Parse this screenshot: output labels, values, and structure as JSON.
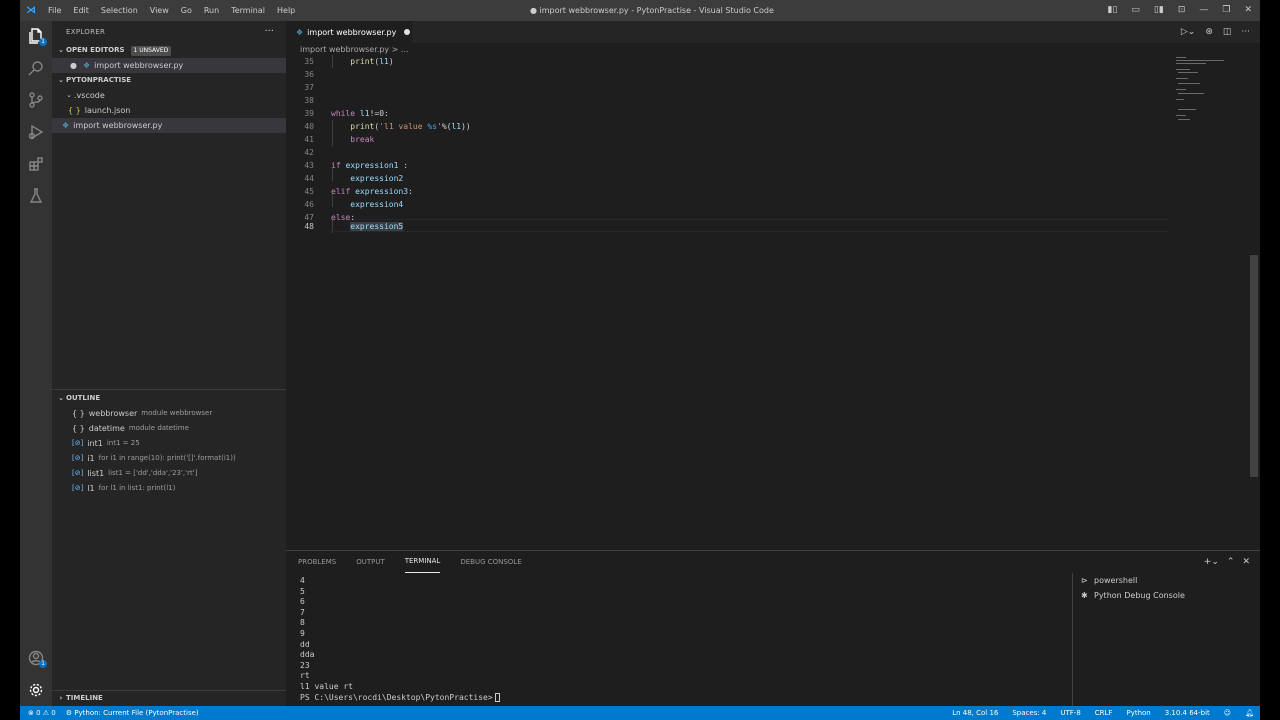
{
  "window": {
    "title": "● import webbrowser.py - PytonPractise - Visual Studio Code",
    "menu": [
      "File",
      "Edit",
      "Selection",
      "View",
      "Go",
      "Run",
      "Terminal",
      "Help"
    ]
  },
  "activity": {
    "explorer_badge": "1",
    "account_badge": "1"
  },
  "sidebar": {
    "header": "EXPLORER",
    "open_editors": {
      "label": "OPEN EDITORS",
      "badge": "1 UNSAVED",
      "file": "import webbrowser.py"
    },
    "folder": {
      "label": "PYTONPRACTISE",
      "subfolder": ".vscode",
      "subfile": "launch.json",
      "file": "import webbrowser.py"
    },
    "outline": {
      "label": "OUTLINE",
      "items": [
        {
          "icon": "{ }",
          "name": "webbrowser",
          "detail": "module webbrowser"
        },
        {
          "icon": "{ }",
          "name": "datetime",
          "detail": "module datetime"
        },
        {
          "icon": "[⊘]",
          "name": "int1",
          "detail": "int1 = 25"
        },
        {
          "icon": "[⊘]",
          "name": "i1",
          "detail": "for i1 in range(10): print('[]'.format(i1))"
        },
        {
          "icon": "[⊘]",
          "name": "list1",
          "detail": "list1 = ['dd','dda','23','rt']"
        },
        {
          "icon": "[⊘]",
          "name": "l1",
          "detail": "for l1 in list1: print(l1)"
        }
      ]
    },
    "timeline": "TIMELINE"
  },
  "editor": {
    "tab": "import webbrowser.py",
    "breadcrumb": "import webbrowser.py > ...",
    "lines": [
      {
        "n": "35",
        "code": "    print(l1)"
      },
      {
        "n": "36",
        "code": ""
      },
      {
        "n": "37",
        "code": ""
      },
      {
        "n": "38",
        "code": ""
      },
      {
        "n": "39",
        "code": "while l1!=0:"
      },
      {
        "n": "40",
        "code": "    print('l1 value %s'%(l1))"
      },
      {
        "n": "41",
        "code": "    break"
      },
      {
        "n": "42",
        "code": ""
      },
      {
        "n": "43",
        "code": "if expression1 :"
      },
      {
        "n": "44",
        "code": "    expression2"
      },
      {
        "n": "45",
        "code": "elif expression3:"
      },
      {
        "n": "46",
        "code": "    expression4"
      },
      {
        "n": "47",
        "code": "else:"
      },
      {
        "n": "48",
        "code": "    expression5"
      }
    ]
  },
  "panel": {
    "tabs": [
      "PROBLEMS",
      "OUTPUT",
      "TERMINAL",
      "DEBUG CONSOLE"
    ],
    "active_tab": "TERMINAL",
    "terminal_lines": [
      "4",
      "5",
      "6",
      "7",
      "8",
      "9",
      "dd",
      "dda",
      "23",
      "rt",
      "l1 value rt"
    ],
    "prompt": "PS C:\\Users\\rocdi\\Desktop\\PytonPractise>",
    "terminals": [
      "powershell",
      "Python Debug Console"
    ]
  },
  "status": {
    "errors": "0",
    "warnings": "0",
    "run_config": "Python: Current File (PytonPractise)",
    "position": "Ln 48, Col 16",
    "spaces": "Spaces: 4",
    "encoding": "UTF-8",
    "eol": "CRLF",
    "language": "Python",
    "interpreter": "3.10.4 64-bit"
  },
  "colors": {
    "accent": "#007acc",
    "titlebar": "#3c3c3c",
    "sidebar": "#252526",
    "editor": "#1e1e1e"
  }
}
